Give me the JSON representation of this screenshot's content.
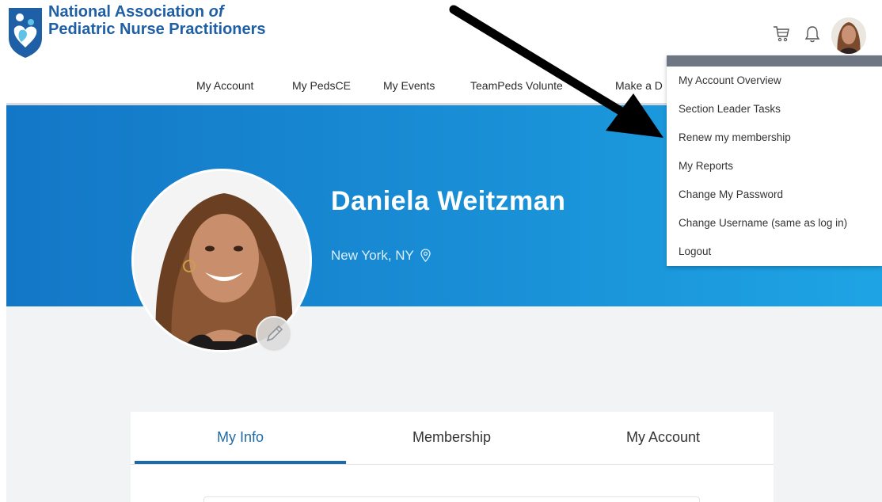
{
  "brand": {
    "line1_a": "National Association ",
    "line1_b": "of",
    "line2": "Pediatric Nurse Practitioners"
  },
  "header_icons": [
    "cart-icon",
    "bell-icon",
    "avatar"
  ],
  "nav": [
    {
      "label": "My Account"
    },
    {
      "label": "My PedsCE"
    },
    {
      "label": "My Events"
    },
    {
      "label": "TeamPeds Volunte"
    },
    {
      "label": "Make a D"
    }
  ],
  "profile": {
    "name": "Daniela Weitzman",
    "location": "New York, NY"
  },
  "tabs": [
    {
      "label": "My Info",
      "active": true
    },
    {
      "label": "Membership",
      "active": false
    },
    {
      "label": "My Account",
      "active": false
    }
  ],
  "dropdown": {
    "items": [
      {
        "label": "My Account Overview"
      },
      {
        "label": "Section Leader Tasks"
      },
      {
        "label": "Renew my membership"
      },
      {
        "label": "My Reports"
      },
      {
        "label": "Change My Password"
      },
      {
        "label": "Change Username (same as log in)"
      },
      {
        "label": "Logout"
      }
    ]
  },
  "colors": {
    "brand_blue": "#1f5fa5",
    "banner_start": "#1377c7",
    "banner_end": "#1ea4e4",
    "active_tab": "#1f6aa5",
    "dropdown_bar": "#6e7683"
  }
}
